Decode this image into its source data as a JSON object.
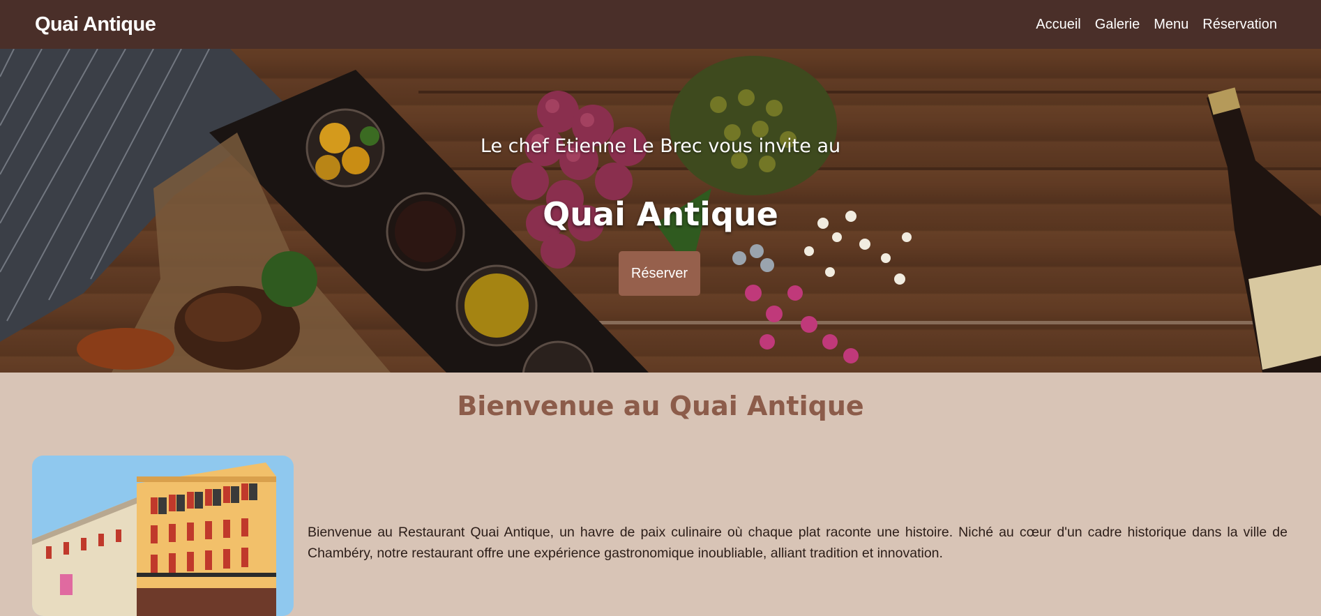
{
  "navbar": {
    "brand": "Quai Antique",
    "links": [
      "Accueil",
      "Galerie",
      "Menu",
      "Réservation"
    ]
  },
  "hero": {
    "subtitle": "Le chef Etienne Le Brec vous invite au",
    "title": "Quai Antique",
    "button_label": "Réserver"
  },
  "welcome": {
    "title": "Bienvenue au Quai Antique",
    "text": "Bienvenue au Restaurant Quai Antique, un havre de paix culinaire où chaque plat raconte une histoire. Niché au cœur d'un cadre historique dans la ville de Chambéry, notre restaurant offre une expérience gastronomique inoubliable, alliant tradition et innovation."
  },
  "colors": {
    "navbar_bg": "#4a2f29",
    "page_bg": "#d8c4b6",
    "accent": "#96604c",
    "heading": "#8c5c4a"
  }
}
